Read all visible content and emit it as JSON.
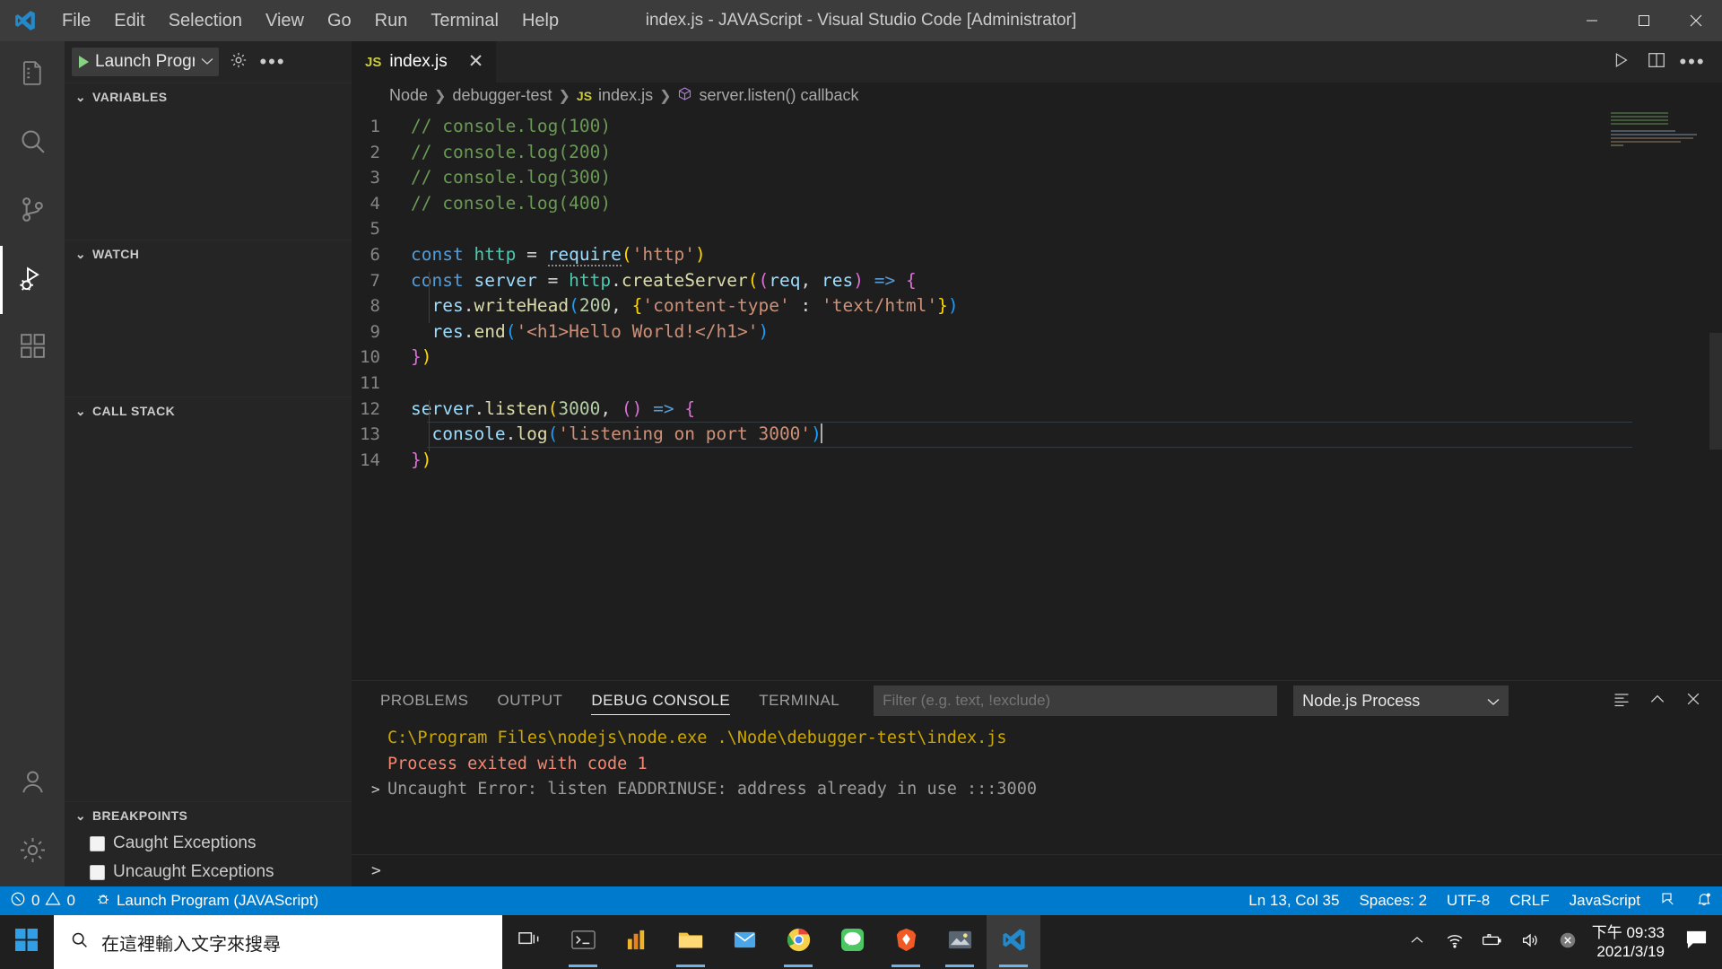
{
  "window": {
    "title": "index.js - JAVAScript - Visual Studio Code [Administrator]",
    "menus": [
      "File",
      "Edit",
      "Selection",
      "View",
      "Go",
      "Run",
      "Terminal",
      "Help"
    ],
    "controls": {
      "minimize": "minimize-icon",
      "maximize": "maximize-icon",
      "close": "close-icon"
    }
  },
  "activity_bar": {
    "items": [
      {
        "name": "explorer",
        "icon": "files-icon",
        "active": false
      },
      {
        "name": "search",
        "icon": "search-icon",
        "active": false
      },
      {
        "name": "source-control",
        "icon": "source-control-icon",
        "active": false
      },
      {
        "name": "run-and-debug",
        "icon": "run-debug-icon",
        "active": true
      },
      {
        "name": "extensions",
        "icon": "extensions-icon",
        "active": false
      }
    ],
    "bottom": [
      {
        "name": "accounts",
        "icon": "account-icon"
      },
      {
        "name": "manage",
        "icon": "gear-icon"
      }
    ]
  },
  "sidebar": {
    "launch_config": "Launch Progra",
    "launch_icon": "play-icon",
    "settings_icon": "gear-icon",
    "more_icon": "ellipsis-icon",
    "sections": [
      {
        "label": "VARIABLES",
        "expanded": true
      },
      {
        "label": "WATCH",
        "expanded": true
      },
      {
        "label": "CALL STACK",
        "expanded": true
      },
      {
        "label": "BREAKPOINTS",
        "expanded": true
      }
    ],
    "breakpoints": [
      {
        "label": "Caught Exceptions",
        "checked": false
      },
      {
        "label": "Uncaught Exceptions",
        "checked": false
      }
    ]
  },
  "editor": {
    "tab": {
      "label": "index.js",
      "icon": "js-file-icon",
      "close": "close-icon"
    },
    "actions": [
      "run-icon",
      "split-editor-icon",
      "ellipsis-icon"
    ],
    "breadcrumbs": [
      {
        "label": "Node",
        "icon": null
      },
      {
        "label": "debugger-test",
        "icon": null
      },
      {
        "label": "index.js",
        "icon": "js-file-icon"
      },
      {
        "label": "server.listen() callback",
        "icon": "symbol-function-icon"
      }
    ],
    "lines": [
      {
        "n": 1,
        "tokens": [
          {
            "t": "// console.log(100)",
            "c": "t-com"
          }
        ]
      },
      {
        "n": 2,
        "tokens": [
          {
            "t": "// console.log(200)",
            "c": "t-com"
          }
        ]
      },
      {
        "n": 3,
        "tokens": [
          {
            "t": "// console.log(300)",
            "c": "t-com"
          }
        ]
      },
      {
        "n": 4,
        "tokens": [
          {
            "t": "// console.log(400)",
            "c": "t-com"
          }
        ]
      },
      {
        "n": 5,
        "tokens": []
      },
      {
        "n": 6,
        "tokens": [
          {
            "t": "const",
            "c": "t-key"
          },
          {
            "t": " ",
            "c": "t-plain"
          },
          {
            "t": "http",
            "c": "t-prop"
          },
          {
            "t": " = ",
            "c": "t-plain"
          },
          {
            "t": "require",
            "c": "t-var squiggle"
          },
          {
            "t": "(",
            "c": "t-p1"
          },
          {
            "t": "'http'",
            "c": "t-str"
          },
          {
            "t": ")",
            "c": "t-p1"
          }
        ]
      },
      {
        "n": 7,
        "tokens": [
          {
            "t": "const",
            "c": "t-key"
          },
          {
            "t": " ",
            "c": "t-plain"
          },
          {
            "t": "server",
            "c": "t-var"
          },
          {
            "t": " = ",
            "c": "t-plain"
          },
          {
            "t": "http",
            "c": "t-prop"
          },
          {
            "t": ".",
            "c": "t-plain"
          },
          {
            "t": "createServer",
            "c": "t-fn"
          },
          {
            "t": "(",
            "c": "t-p1"
          },
          {
            "t": "(",
            "c": "t-p2"
          },
          {
            "t": "req",
            "c": "t-var"
          },
          {
            "t": ", ",
            "c": "t-plain"
          },
          {
            "t": "res",
            "c": "t-var"
          },
          {
            "t": ")",
            "c": "t-p2"
          },
          {
            "t": " ",
            "c": "t-plain"
          },
          {
            "t": "=>",
            "c": "t-key"
          },
          {
            "t": " ",
            "c": "t-plain"
          },
          {
            "t": "{",
            "c": "t-p2"
          }
        ]
      },
      {
        "n": 8,
        "tokens": [
          {
            "t": "  ",
            "c": "t-plain"
          },
          {
            "t": "res",
            "c": "t-var"
          },
          {
            "t": ".",
            "c": "t-plain"
          },
          {
            "t": "writeHead",
            "c": "t-fn"
          },
          {
            "t": "(",
            "c": "t-p3"
          },
          {
            "t": "200",
            "c": "t-num"
          },
          {
            "t": ", ",
            "c": "t-plain"
          },
          {
            "t": "{",
            "c": "t-p1"
          },
          {
            "t": "'content-type'",
            "c": "t-str"
          },
          {
            "t": " : ",
            "c": "t-plain"
          },
          {
            "t": "'text/html'",
            "c": "t-str"
          },
          {
            "t": "}",
            "c": "t-p1"
          },
          {
            "t": ")",
            "c": "t-p3"
          }
        ]
      },
      {
        "n": 9,
        "tokens": [
          {
            "t": "  ",
            "c": "t-plain"
          },
          {
            "t": "res",
            "c": "t-var"
          },
          {
            "t": ".",
            "c": "t-plain"
          },
          {
            "t": "end",
            "c": "t-fn"
          },
          {
            "t": "(",
            "c": "t-p3"
          },
          {
            "t": "'<h1>Hello World!</h1>'",
            "c": "t-str"
          },
          {
            "t": ")",
            "c": "t-p3"
          }
        ]
      },
      {
        "n": 10,
        "tokens": [
          {
            "t": "}",
            "c": "t-p2"
          },
          {
            "t": ")",
            "c": "t-p1"
          }
        ]
      },
      {
        "n": 11,
        "tokens": []
      },
      {
        "n": 12,
        "tokens": [
          {
            "t": "server",
            "c": "t-var"
          },
          {
            "t": ".",
            "c": "t-plain"
          },
          {
            "t": "listen",
            "c": "t-fn"
          },
          {
            "t": "(",
            "c": "t-p1"
          },
          {
            "t": "3000",
            "c": "t-num"
          },
          {
            "t": ", ",
            "c": "t-plain"
          },
          {
            "t": "(",
            "c": "t-p2"
          },
          {
            "t": ")",
            "c": "t-p2"
          },
          {
            "t": " ",
            "c": "t-plain"
          },
          {
            "t": "=>",
            "c": "t-key"
          },
          {
            "t": " ",
            "c": "t-plain"
          },
          {
            "t": "{",
            "c": "t-p2"
          }
        ]
      },
      {
        "n": 13,
        "active": true,
        "tokens": [
          {
            "t": "  ",
            "c": "t-plain"
          },
          {
            "t": "console",
            "c": "t-var"
          },
          {
            "t": ".",
            "c": "t-plain"
          },
          {
            "t": "log",
            "c": "t-fn"
          },
          {
            "t": "(",
            "c": "t-p3"
          },
          {
            "t": "'listening on port 3000'",
            "c": "t-str"
          },
          {
            "t": ")",
            "c": "t-p3"
          }
        ]
      },
      {
        "n": 14,
        "tokens": [
          {
            "t": "}",
            "c": "t-p2"
          },
          {
            "t": ")",
            "c": "t-p1"
          }
        ]
      }
    ]
  },
  "panel": {
    "tabs": [
      {
        "label": "PROBLEMS",
        "active": false
      },
      {
        "label": "OUTPUT",
        "active": false
      },
      {
        "label": "DEBUG CONSOLE",
        "active": true
      },
      {
        "label": "TERMINAL",
        "active": false
      }
    ],
    "filter_placeholder": "Filter (e.g. text, !exclude)",
    "filter_value": "",
    "process_select": "Node.js Process",
    "actions": [
      "clear-console-icon",
      "chevron-up-icon",
      "close-icon"
    ],
    "console_lines": [
      {
        "text": "C:\\Program Files\\nodejs\\node.exe .\\Node\\debugger-test\\index.js",
        "cls": "c-warn",
        "gutter": ""
      },
      {
        "text": "Process exited with code 1",
        "cls": "c-err",
        "gutter": ""
      },
      {
        "text": "Uncaught Error: listen EADDRINUSE: address already in use :::3000",
        "cls": "c-dim",
        "gutter": ">"
      }
    ],
    "prompt": ">"
  },
  "status_bar": {
    "left": [
      {
        "name": "problems",
        "icon": "error-warning-icon",
        "text": "0  0"
      },
      {
        "name": "launch-program",
        "icon": "debug-alt-icon",
        "text": "Launch Program (JAVAScript)"
      }
    ],
    "right": [
      {
        "name": "cursor-position",
        "text": "Ln 13, Col 35"
      },
      {
        "name": "indentation",
        "text": "Spaces: 2"
      },
      {
        "name": "encoding",
        "text": "UTF-8"
      },
      {
        "name": "eol",
        "text": "CRLF"
      },
      {
        "name": "language-mode",
        "text": "JavaScript"
      },
      {
        "name": "feedback",
        "icon": "feedback-icon",
        "text": ""
      },
      {
        "name": "notifications",
        "icon": "bell-dot-icon",
        "text": ""
      }
    ],
    "accent": "#007acc"
  },
  "taskbar": {
    "search_placeholder": "在這裡輸入文字來搜尋",
    "start_icon": "windows-start-icon",
    "apps": [
      {
        "name": "task-view",
        "icon": "task-view-icon",
        "running": false,
        "focused": false
      },
      {
        "name": "terminal",
        "icon": "terminal-app-icon",
        "running": true,
        "focused": false
      },
      {
        "name": "store",
        "icon": "store-app-icon",
        "running": false,
        "focused": false
      },
      {
        "name": "file-explorer",
        "icon": "folder-icon",
        "running": true,
        "focused": false
      },
      {
        "name": "mail",
        "icon": "mail-icon",
        "running": false,
        "focused": false
      },
      {
        "name": "chrome",
        "icon": "chrome-icon",
        "running": true,
        "focused": false
      },
      {
        "name": "line",
        "icon": "line-icon",
        "running": false,
        "focused": false
      },
      {
        "name": "brave",
        "icon": "brave-icon",
        "running": true,
        "focused": false
      },
      {
        "name": "photos",
        "icon": "photos-icon",
        "running": true,
        "focused": false
      },
      {
        "name": "vscode",
        "icon": "vscode-icon",
        "running": true,
        "focused": true
      }
    ],
    "tray": [
      "chevron-up-icon",
      "wifi-icon",
      "battery-icon",
      "volume-icon",
      "sync-error-icon"
    ],
    "clock_time": "下午 09:33",
    "clock_date": "2021/3/19",
    "notification_icon": "action-center-icon"
  }
}
